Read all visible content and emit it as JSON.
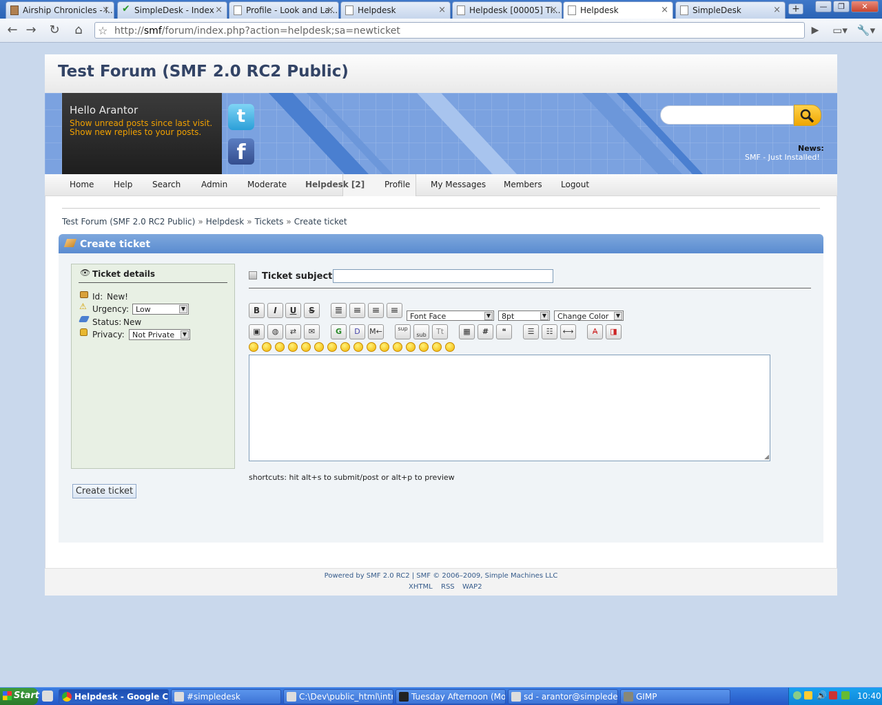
{
  "browser": {
    "tabs": [
      {
        "label": "Airship Chronicles - I..."
      },
      {
        "label": "SimpleDesk - Index"
      },
      {
        "label": "Profile - Look and La..."
      },
      {
        "label": "Helpdesk"
      },
      {
        "label": "Helpdesk [00005] Ti..."
      },
      {
        "label": "Helpdesk"
      },
      {
        "label": "SimpleDesk"
      }
    ],
    "url_prefix": "http://",
    "url_host": "smf",
    "url_rest": "/forum/index.php?action=helpdesk;sa=newticket"
  },
  "forum": {
    "title": "Test Forum (SMF 2.0 RC2 Public)",
    "hello": "Hello Arantor",
    "unread_link": "Show unread posts since last visit.",
    "replies_link": "Show new replies to your posts.",
    "news_label": "News:",
    "news_text": "SMF - Just Installed!",
    "menu": [
      "Home",
      "Help",
      "Search",
      "Admin",
      "Moderate",
      "Helpdesk [2]",
      "Profile",
      "My Messages",
      "Members",
      "Logout"
    ],
    "breadcrumb": [
      "Test Forum (SMF 2.0 RC2 Public)",
      "Helpdesk",
      "Tickets",
      "Create ticket"
    ],
    "breadcrumb_sep": "»",
    "page_heading": "Create ticket"
  },
  "ticket": {
    "details_heading": "Ticket details",
    "id_label": "Id:",
    "id_value": "New!",
    "urgency_label": "Urgency:",
    "urgency_value": "Low",
    "status_label": "Status:",
    "status_value": "New",
    "privacy_label": "Privacy:",
    "privacy_value": "Not Private",
    "subject_label": "Ticket subject:",
    "subject_value": "",
    "create_button": "Create ticket",
    "shortcuts": "shortcuts: hit alt+s to submit/post or alt+p to preview"
  },
  "editor": {
    "format_buttons": [
      "B",
      "I",
      "U",
      "S"
    ],
    "font_face": "Font Face",
    "font_size": "8pt",
    "font_color": "Change Color",
    "row2_buttons": [
      "img",
      "url",
      "ftp",
      "email",
      "G",
      "D",
      "M←",
      "sup",
      "sub",
      "Tt",
      "tbl",
      "#",
      "quote",
      "ul",
      "ol",
      "hr",
      "rm",
      "src"
    ],
    "smiley_count": 16
  },
  "footer": {
    "powered": "Powered by SMF 2.0 RC2 | SMF © 2006–2009, Simple Machines LLC",
    "links": [
      "XHTML",
      "RSS",
      "WAP2"
    ]
  },
  "taskbar": {
    "start": "Start",
    "tasks": [
      {
        "label": "Helpdesk - Google Ch..."
      },
      {
        "label": "#simpledesk"
      },
      {
        "label": "C:\\Dev\\public_html\\intra..."
      },
      {
        "label": "Tuesday Afternoon (Moo..."
      },
      {
        "label": "sd - arantor@simpledesk..."
      },
      {
        "label": "GIMP"
      }
    ],
    "clock": "10:40"
  },
  "colors": {
    "accent": "#5a8bd0",
    "title": "#334466",
    "link_orange": "#f0a000",
    "details_bg": "#e8f0e4"
  }
}
